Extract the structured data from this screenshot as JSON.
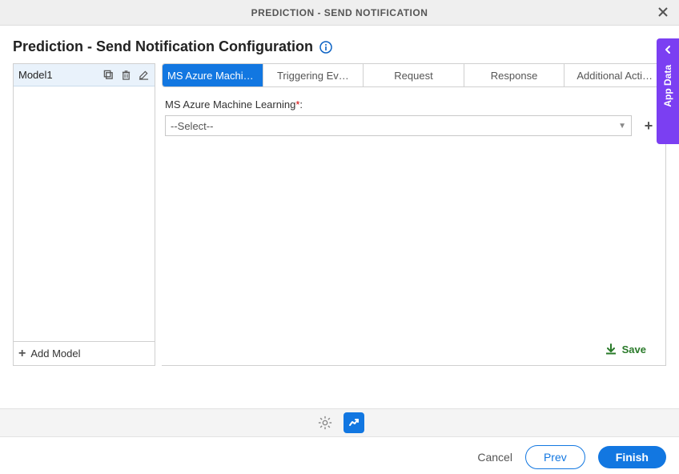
{
  "titlebar": {
    "text": "PREDICTION - SEND NOTIFICATION"
  },
  "heading": "Prediction - Send Notification Configuration",
  "sidebar": {
    "model_name": "Model1",
    "add_model": "Add Model"
  },
  "tabs": [
    {
      "label": "MS Azure Machine Lear…",
      "active": true
    },
    {
      "label": "Triggering Ev…",
      "active": false
    },
    {
      "label": "Request",
      "active": false
    },
    {
      "label": "Response",
      "active": false
    },
    {
      "label": "Additional Acti…",
      "active": false
    }
  ],
  "form": {
    "label": "MS Azure Machine Learning",
    "required_marker": "*",
    "select_value": "--Select--"
  },
  "save_label": "Save",
  "sidetab_label": "App Data",
  "footer": {
    "cancel": "Cancel",
    "prev": "Prev",
    "finish": "Finish"
  }
}
